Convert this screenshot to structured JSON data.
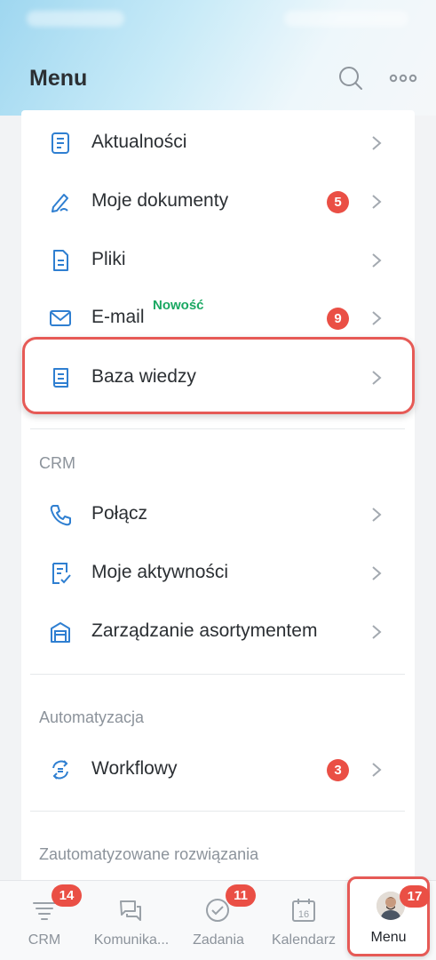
{
  "header": {
    "title": "Menu"
  },
  "menu_items": [
    {
      "label": "Aktualności",
      "icon": "news-icon"
    },
    {
      "label": "Moje dokumenty",
      "icon": "pen-icon",
      "badge": "5"
    },
    {
      "label": "Pliki",
      "icon": "file-icon"
    },
    {
      "label": "E-mail",
      "icon": "mail-icon",
      "badge": "9",
      "tag": "Nowość"
    },
    {
      "label": "Baza wiedzy",
      "icon": "book-icon"
    }
  ],
  "crm": {
    "section_label": "CRM",
    "items": [
      {
        "label": "Połącz",
        "icon": "phone-icon"
      },
      {
        "label": "Moje aktywności",
        "icon": "activity-icon"
      },
      {
        "label": "Zarządzanie asortymentem",
        "icon": "store-icon"
      }
    ]
  },
  "automation": {
    "section_label": "Automatyzacja",
    "items": [
      {
        "label": "Workflowy",
        "icon": "workflow-icon",
        "badge": "3"
      }
    ]
  },
  "solutions": {
    "section_label": "Zautomatyzowane rozwiązania"
  },
  "bottom_nav": [
    {
      "label": "CRM",
      "icon": "crm-funnel-icon",
      "badge": "14"
    },
    {
      "label": "Komunika...",
      "icon": "chat-icon"
    },
    {
      "label": "Zadania",
      "icon": "check-circle-icon",
      "badge": "11"
    },
    {
      "label": "Kalendarz",
      "icon": "calendar-icon",
      "day": "16"
    },
    {
      "label": "Menu",
      "icon": "avatar",
      "badge": "17",
      "active": true
    }
  ],
  "colors": {
    "accent_blue": "#2f7fd1",
    "badge_red": "#ea4f45",
    "new_green": "#1aa862",
    "highlight": "#e65a56"
  }
}
